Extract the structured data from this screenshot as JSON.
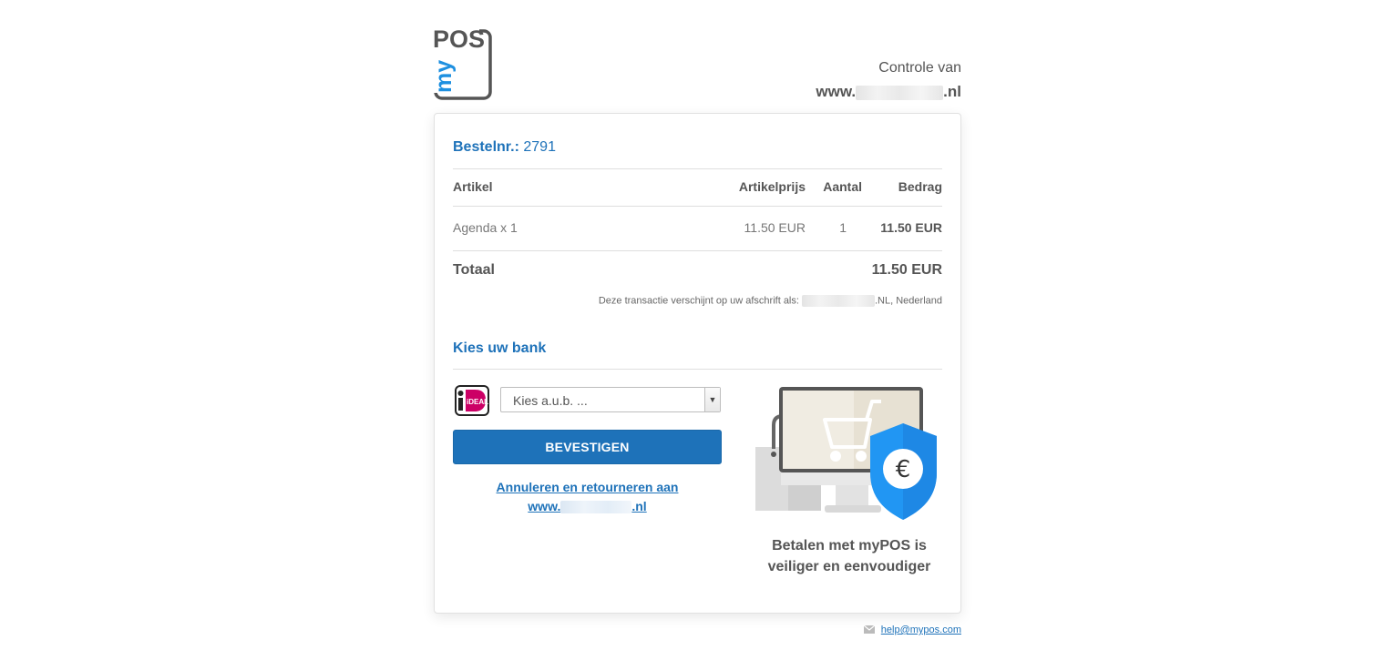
{
  "brand": {
    "logo_text_top": "POS",
    "logo_text_side": "my"
  },
  "header": {
    "verify_label": "Controle van",
    "site_prefix": "www.",
    "site_suffix": ".nl"
  },
  "order": {
    "label": "Bestelnr.:",
    "number": "2791"
  },
  "table": {
    "headers": {
      "item": "Artikel",
      "price": "Artikelprijs",
      "qty": "Aantal",
      "amount": "Bedrag"
    },
    "rows": [
      {
        "item": "Agenda x 1",
        "price": "11.50 EUR",
        "qty": "1",
        "amount": "11.50 EUR"
      }
    ],
    "total_label": "Totaal",
    "total_value": "11.50 EUR"
  },
  "statement": {
    "prefix": "Deze transactie verschijnt op uw afschrift als:",
    "suffix": ".NL, Nederland"
  },
  "bank": {
    "title": "Kies uw bank",
    "ideal_text": "iDEAL",
    "select_value": "Kies a.u.b. ...",
    "confirm_label": "BEVESTIGEN",
    "cancel_line1": "Annuleren en retourneren aan",
    "cancel_prefix": "www.",
    "cancel_suffix": ".nl"
  },
  "promo": {
    "line1": "Betalen met myPOS is",
    "line2": "veiliger en eenvoudiger",
    "euro_symbol": "€"
  },
  "footer": {
    "help_email": "help@mypos.com",
    "mail_icon": "envelope-icon"
  },
  "colors": {
    "accent": "#1e72b9",
    "ideal_pink": "#cc0066",
    "shield_blue": "#2196f3"
  }
}
